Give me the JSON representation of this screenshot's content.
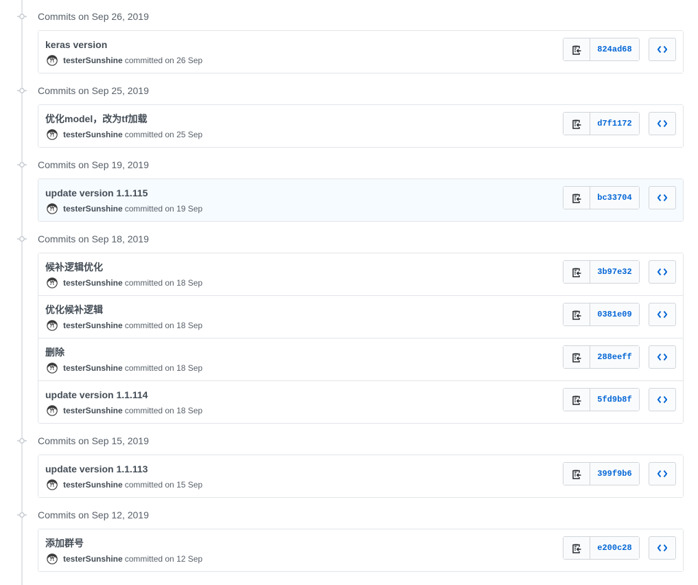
{
  "colors": {
    "accent": "#0366d6",
    "border": "#e1e4e8",
    "muted": "#586069",
    "highlight_row": "#f6fbff"
  },
  "icons": {
    "node": "git-commit-icon",
    "copy": "clippy-icon",
    "browse": "code-icon",
    "avatar": "avatar-icon"
  },
  "groups": [
    {
      "title": "Commits on Sep 26, 2019",
      "commits": [
        {
          "message": "keras version",
          "author": "testerSunshine",
          "committed": "committed on 26 Sep",
          "sha": "824ad68",
          "highlight": false
        }
      ]
    },
    {
      "title": "Commits on Sep 25, 2019",
      "commits": [
        {
          "message": "优化model，改为tf加载",
          "author": "testerSunshine",
          "committed": "committed on 25 Sep",
          "sha": "d7f1172",
          "highlight": false
        }
      ]
    },
    {
      "title": "Commits on Sep 19, 2019",
      "commits": [
        {
          "message": "update version 1.1.115",
          "author": "testerSunshine",
          "committed": "committed on 19 Sep",
          "sha": "bc33704",
          "highlight": true
        }
      ]
    },
    {
      "title": "Commits on Sep 18, 2019",
      "commits": [
        {
          "message": "候补逻辑优化",
          "author": "testerSunshine",
          "committed": "committed on 18 Sep",
          "sha": "3b97e32",
          "highlight": false
        },
        {
          "message": "优化候补逻辑",
          "author": "testerSunshine",
          "committed": "committed on 18 Sep",
          "sha": "0381e09",
          "highlight": false
        },
        {
          "message": "删除",
          "author": "testerSunshine",
          "committed": "committed on 18 Sep",
          "sha": "288eeff",
          "highlight": false
        },
        {
          "message": "update version 1.1.114",
          "author": "testerSunshine",
          "committed": "committed on 18 Sep",
          "sha": "5fd9b8f",
          "highlight": false
        }
      ]
    },
    {
      "title": "Commits on Sep 15, 2019",
      "commits": [
        {
          "message": "update version 1.1.113",
          "author": "testerSunshine",
          "committed": "committed on 15 Sep",
          "sha": "399f9b6",
          "highlight": false
        }
      ]
    },
    {
      "title": "Commits on Sep 12, 2019",
      "commits": [
        {
          "message": "添加群号",
          "author": "testerSunshine",
          "committed": "committed on 12 Sep",
          "sha": "e200c28",
          "highlight": false
        }
      ]
    }
  ]
}
